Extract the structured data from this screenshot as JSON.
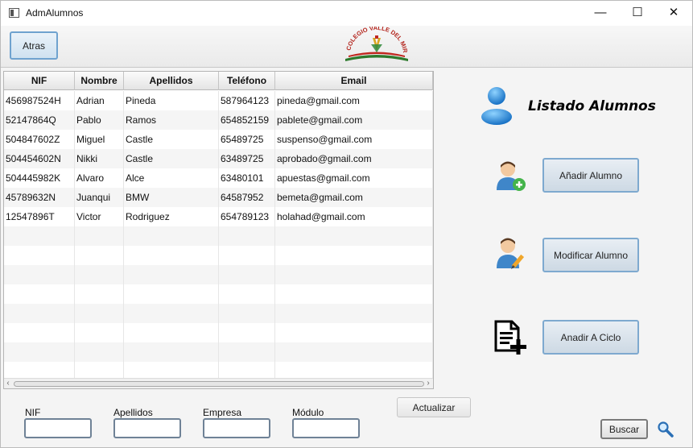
{
  "window": {
    "title": "AdmAlumnos",
    "minimize_label": "—",
    "maximize_label": "☐",
    "close_label": "✕"
  },
  "toolbar": {
    "back_label": "Atras",
    "logo_text": "COLEGIO VALLE DEL MIRO"
  },
  "table": {
    "columns": [
      "NIF",
      "Nombre",
      "Apellidos",
      "Teléfono",
      "Email"
    ],
    "rows": [
      [
        "456987524H",
        "Adrian",
        "Pineda",
        "587964123",
        "pineda@gmail.com"
      ],
      [
        "52147864Q",
        "Pablo",
        "Ramos",
        "654852159",
        "pablete@gmail.com"
      ],
      [
        "504847602Z",
        "Miguel",
        "Castle",
        "65489725",
        "suspenso@gmail.com"
      ],
      [
        "504454602N",
        "Nikki",
        "Castle",
        "63489725",
        "aprobado@gmail.com"
      ],
      [
        "504445982K",
        "Alvaro",
        "Alce",
        "63480101",
        "apuestas@gmail.com"
      ],
      [
        "45789632N",
        "Juanqui",
        "BMW",
        "64587952",
        "bemeta@gmail.com"
      ],
      [
        "12547896T",
        "Victor",
        "Rodriguez",
        "654789123",
        "holahad@gmail.com"
      ]
    ],
    "empty_rows": 8
  },
  "panel": {
    "title": "Listado Alumnos",
    "add_label": "Añadir Alumno",
    "modify_label": "Modificar Alumno",
    "add_cycle_label": "Anadir A Ciclo"
  },
  "filters": {
    "nif_label": "NIF",
    "apellidos_label": "Apellidos",
    "empresa_label": "Empresa",
    "modulo_label": "Módulo",
    "nif_value": "",
    "apellidos_value": "",
    "empresa_value": "",
    "modulo_value": ""
  },
  "actions": {
    "refresh_label": "Actualizar",
    "search_label": "Buscar"
  },
  "icons": {
    "user_group": "users-icon",
    "add_user": "add-user-icon",
    "edit_user": "edit-user-icon",
    "add_document": "add-document-icon",
    "search": "search-icon"
  }
}
